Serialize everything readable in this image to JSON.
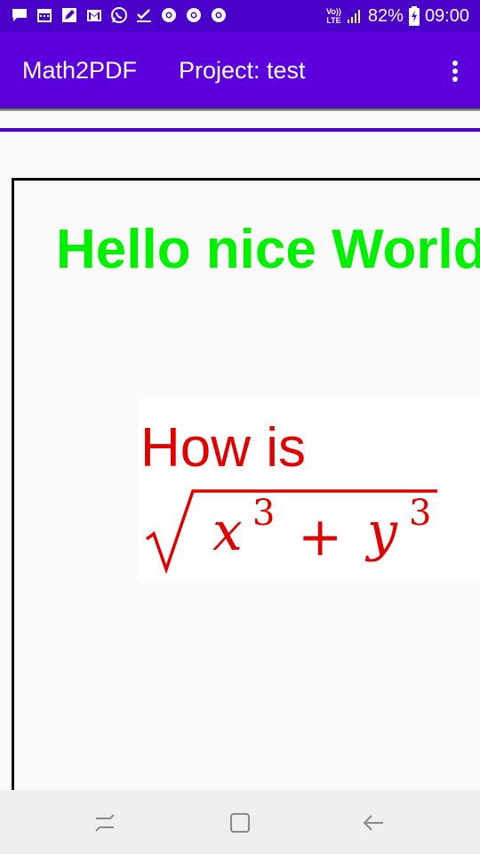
{
  "status_bar": {
    "notification_icons": [
      "chat-icon",
      "calendar-icon",
      "edit-icon",
      "gmail-icon",
      "whatsapp-icon",
      "check-icon",
      "chrome-icon",
      "chrome-icon",
      "chrome-icon"
    ],
    "network_badge": "LTE",
    "volte_badge": "Vo))",
    "battery": "82%",
    "time": "09:00"
  },
  "app_bar": {
    "app_name": "Math2PDF",
    "project_label": "Project: test"
  },
  "document": {
    "heading": "Hello nice World",
    "question": "How is",
    "formula_latex": "\\sqrt{x^3 + y^3}",
    "colors": {
      "heading": "#00f000",
      "question": "#e00000"
    }
  },
  "navigation": [
    "recents-icon",
    "home-icon",
    "back-icon"
  ]
}
